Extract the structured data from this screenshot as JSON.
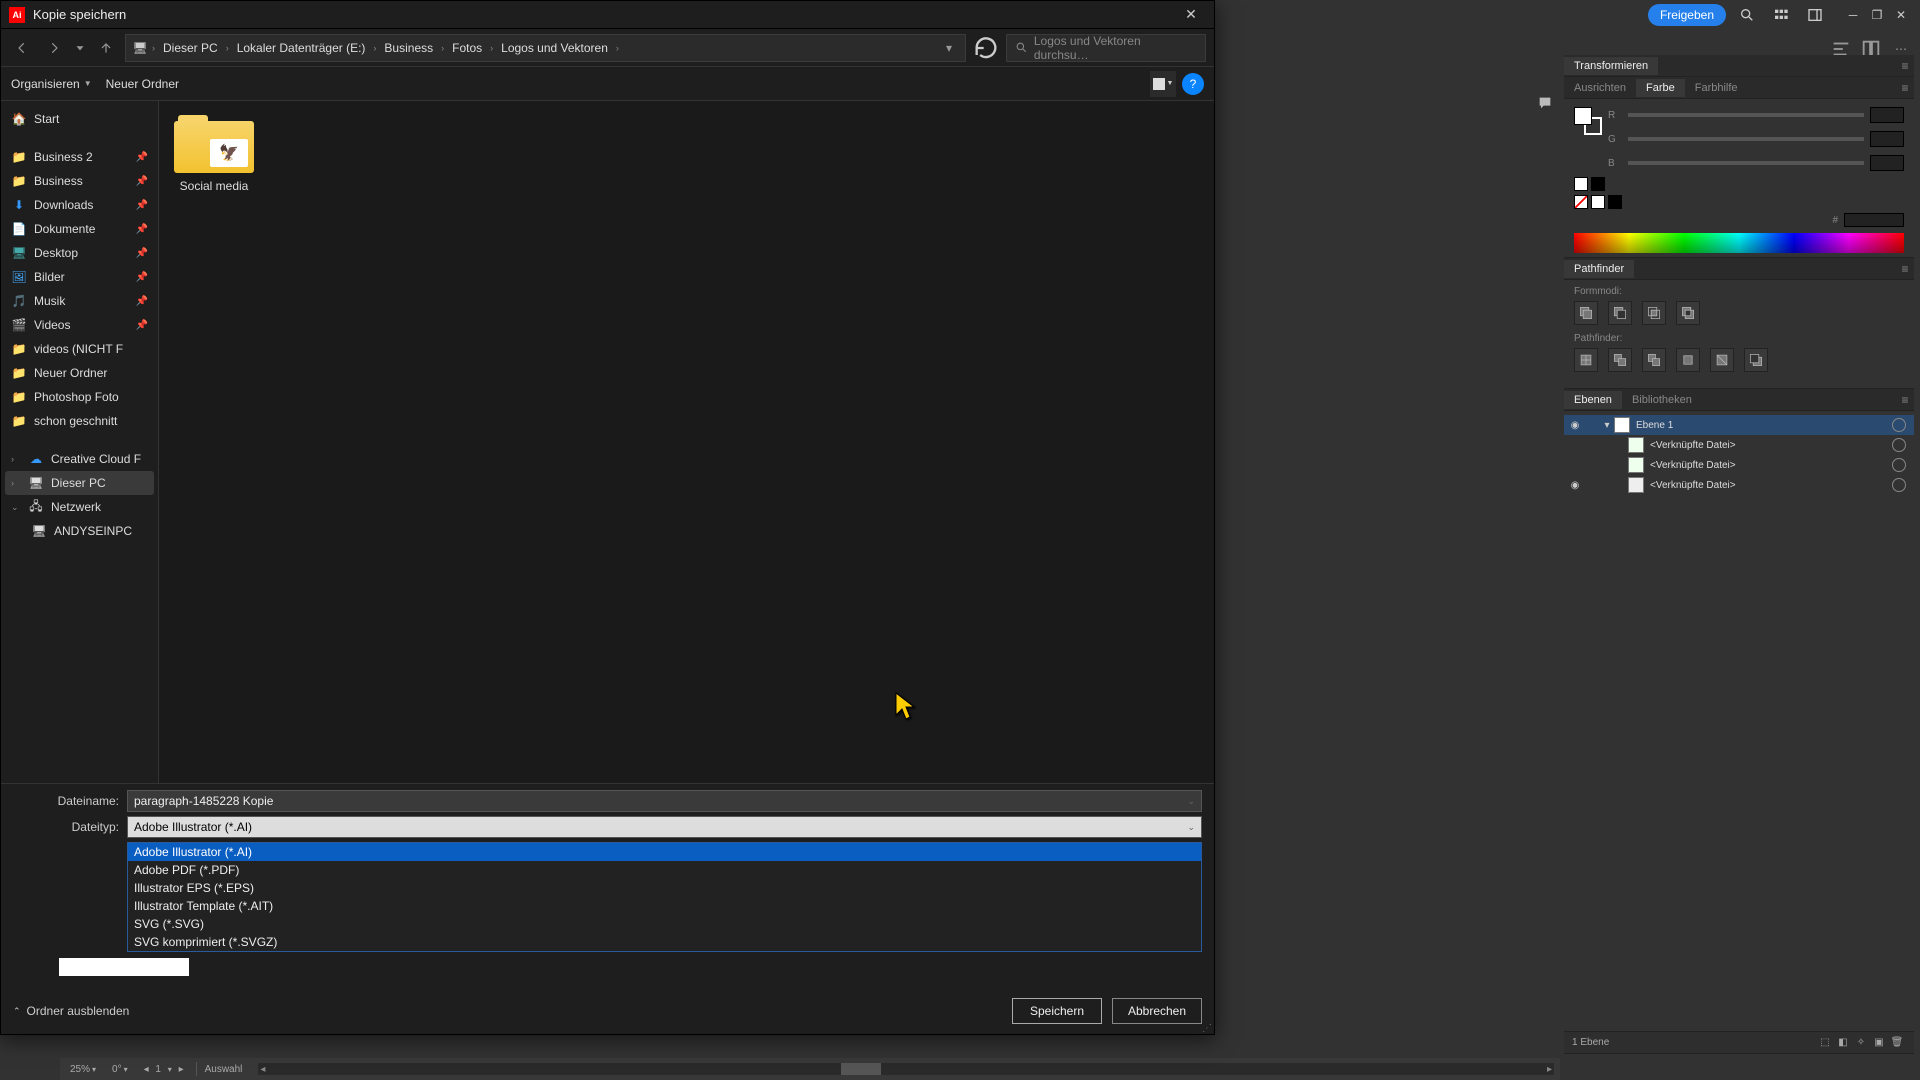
{
  "app": {
    "share": "Freigeben"
  },
  "dialog": {
    "title": "Kopie speichern",
    "breadcrumb": [
      "Dieser PC",
      "Lokaler Datenträger (E:)",
      "Business",
      "Fotos",
      "Logos und Vektoren"
    ],
    "search_placeholder": "Logos und Vektoren durchsu…",
    "organize": "Organisieren",
    "new_folder": "Neuer Ordner",
    "filename_label": "Dateiname:",
    "filename_value": "paragraph-1485228 Kopie",
    "filetype_label": "Dateityp:",
    "filetype_value": "Adobe Illustrator (*.AI)",
    "options": [
      "Adobe Illustrator (*.AI)",
      "Adobe PDF (*.PDF)",
      "Illustrator EPS (*.EPS)",
      "Illustrator Template (*.AIT)",
      "SVG (*.SVG)",
      "SVG komprimiert (*.SVGZ)"
    ],
    "hide_folders": "Ordner ausblenden",
    "save": "Speichern",
    "cancel": "Abbrechen"
  },
  "sidebar": {
    "start": "Start",
    "quick": [
      "Business 2",
      "Business",
      "Downloads",
      "Dokumente",
      "Desktop",
      "Bilder",
      "Musik",
      "Videos",
      "videos (NICHT F",
      "Neuer Ordner",
      "Photoshop Foto",
      "schon geschnitt"
    ],
    "tree": [
      "Creative Cloud F",
      "Dieser PC",
      "Netzwerk"
    ],
    "network_child": "ANDYSEINPC"
  },
  "files": {
    "folder1": "Social media"
  },
  "panels": {
    "transform": "Transformieren",
    "align": "Ausrichten",
    "color": "Farbe",
    "colorguide": "Farbhilfe",
    "r": "R",
    "g": "G",
    "b": "B",
    "hash": "#",
    "pathfinder": "Pathfinder",
    "shapemodes": "Formmodi:",
    "pathfinders": "Pathfinder:",
    "layers": "Ebenen",
    "libraries": "Bibliotheken",
    "layer1": "Ebene 1",
    "linked": "<Verknüpfte Datei>",
    "layer_count": "1 Ebene"
  },
  "status": {
    "zoom": "25%",
    "rotate": "0°",
    "artboard": "1",
    "tool": "Auswahl"
  }
}
